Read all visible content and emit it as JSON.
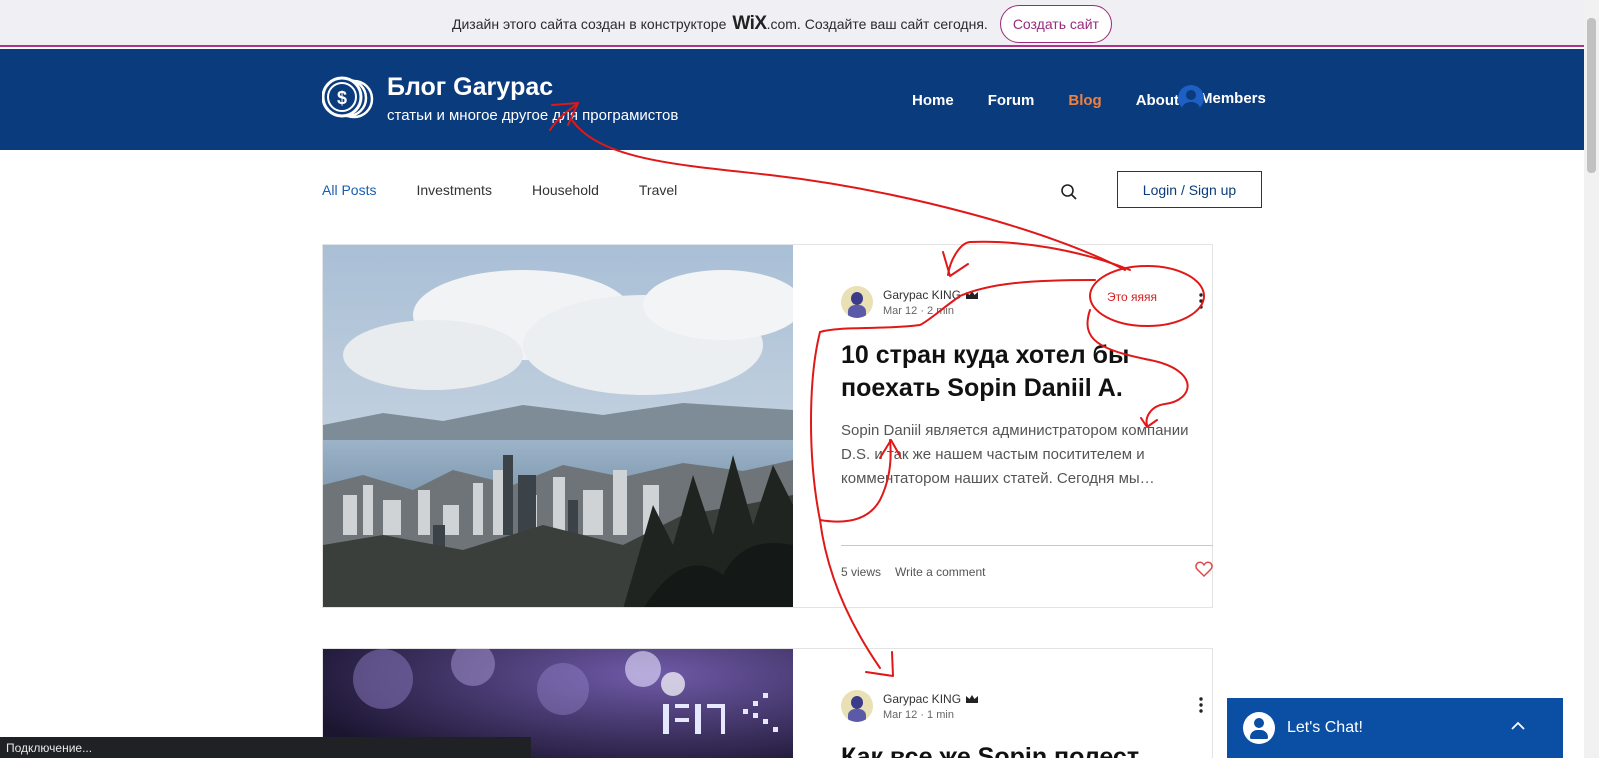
{
  "wix_banner": {
    "text_before": "Дизайн этого сайта создан в конструкторе",
    "wix_logo": "WiX",
    "text_after": ".com. Создайте ваш сайт сегодня.",
    "cta_label": "Создать сайт"
  },
  "header": {
    "logo_icon": "coins-icon",
    "title": "Блог Garypac",
    "tagline": "статьи и многое другое для програмистов",
    "nav": [
      {
        "label": "Home",
        "active": false
      },
      {
        "label": "Forum",
        "active": false
      },
      {
        "label": "Blog",
        "active": true
      },
      {
        "label": "About",
        "active": false
      }
    ],
    "members_label": "Members"
  },
  "categories": {
    "items": [
      {
        "label": "All Posts",
        "active": true
      },
      {
        "label": "Investments",
        "active": false
      },
      {
        "label": "Household",
        "active": false
      },
      {
        "label": "Travel",
        "active": false
      }
    ],
    "login_label": "Login / Sign up"
  },
  "posts": [
    {
      "author": "Garypac KING",
      "date": "Mar 12",
      "read_time": "2 min",
      "title": "10 стран куда хотел бы поехать Sopin Daniil A.",
      "excerpt": "Sopin Daniil является администратором компании D.S. и так же нашем частым поситителем и комментатором наших статей. Сегодня мы…",
      "views": "5 views",
      "comment_link": "Write a comment"
    },
    {
      "author": "Garypac KING",
      "date": "Mar 12",
      "read_time": "1 min",
      "title": "Как все же Sopin полест"
    }
  ],
  "annotation": {
    "label": "Это яяяя",
    "color": "#d42020"
  },
  "chat": {
    "label": "Let's Chat!"
  },
  "status_bar": {
    "text": "Подключение..."
  },
  "colors": {
    "header_bg": "#0a3b7c",
    "nav_active": "#f0813c",
    "wix_accent": "#9b2a7c",
    "chat_bg": "#0a4fa3"
  }
}
